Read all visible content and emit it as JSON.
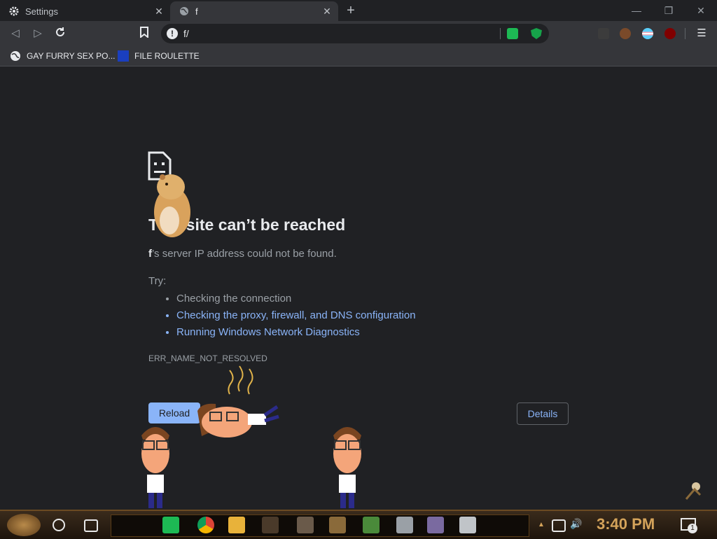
{
  "tabs": [
    {
      "title": "Settings",
      "icon": "gear-icon",
      "active": false
    },
    {
      "title": "f",
      "icon": "globe-icon",
      "active": true
    }
  ],
  "omnibox": {
    "url": "f/"
  },
  "bookmarks": [
    {
      "label": "GAY FURRY SEX PO...",
      "icon": "globe-icon"
    },
    {
      "label": "FILE ROULETTE",
      "icon": "mft-icon"
    }
  ],
  "error": {
    "headline": "This site can’t be reached",
    "host": "f",
    "message": "’s server IP address could not be found.",
    "try_label": "Try:",
    "suggestions": [
      {
        "text": "Checking the connection",
        "link": false
      },
      {
        "text": "Checking the proxy, firewall, and DNS configuration",
        "link": true
      },
      {
        "text": "Running Windows Network Diagnostics",
        "link": true
      }
    ],
    "code": "ERR_NAME_NOT_RESOLVED",
    "reload_label": "Reload",
    "details_label": "Details"
  },
  "taskbar": {
    "clock": "3:40 PM",
    "notification_count": "1"
  },
  "colors": {
    "accent": "#8ab4f8",
    "background": "#202124",
    "clock": "#d4a35a"
  }
}
